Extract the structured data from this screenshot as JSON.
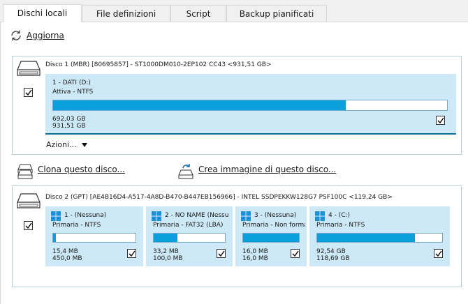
{
  "tabs": [
    {
      "label": "Dischi locali",
      "active": true
    },
    {
      "label": "File definizioni",
      "active": false
    },
    {
      "label": "Script",
      "active": false
    },
    {
      "label": "Backup pianificati",
      "active": false
    }
  ],
  "toolbar": {
    "refresh_label": "Aggiorna",
    "refresh_icon": "refresh-icon"
  },
  "disk1": {
    "header": "Disco 1 (MBR) [80695857] - ST1000DM010-2EP102 CC43  <931,51 GB>",
    "checked": true,
    "partition": {
      "title": "1 - DATI (D:)",
      "subtitle": "Attiva - NTFS",
      "used": "692,03 GB",
      "total": "931,51 GB",
      "usage_fraction": 0.743,
      "checked": true
    },
    "actions_label": "Azioni...",
    "clone_label": "Clona questo disco...",
    "image_label": "Crea immagine di questo disco..."
  },
  "disk2": {
    "header": "Disco 2 (GPT) [AE4B16D4-A517-4A8D-B470-B447EB156966] - INTEL SSDPEKKW128G7 PSF100C  <119,24 GB>",
    "checked": true,
    "partitions": [
      {
        "title": "1 -  (Nessuna)",
        "subtitle": "Primaria - NTFS",
        "used": "15,4 MB",
        "total": "450,0 MB",
        "usage_fraction": 0.03,
        "checked": true
      },
      {
        "title": "2 - NO NAME (Nessu",
        "subtitle": "Primaria - FAT32 (LBA)",
        "used": "33,2 MB",
        "total": "100,0 MB",
        "usage_fraction": 0.33,
        "checked": true
      },
      {
        "title": "3 -  (Nessuna)",
        "subtitle": "Primaria - Non forma",
        "used": "16,0 MB",
        "total": "16,0 MB",
        "usage_fraction": 1.0,
        "checked": true
      },
      {
        "title": "4 -  (C:)",
        "subtitle": "Primaria - NTFS",
        "used": "92,54 GB",
        "total": "118,69 GB",
        "usage_fraction": 0.78,
        "checked": true
      }
    ]
  },
  "colors": {
    "accent": "#0b9fdd",
    "partition_bg": "#cde8f6",
    "border": "#b9cfe0"
  }
}
